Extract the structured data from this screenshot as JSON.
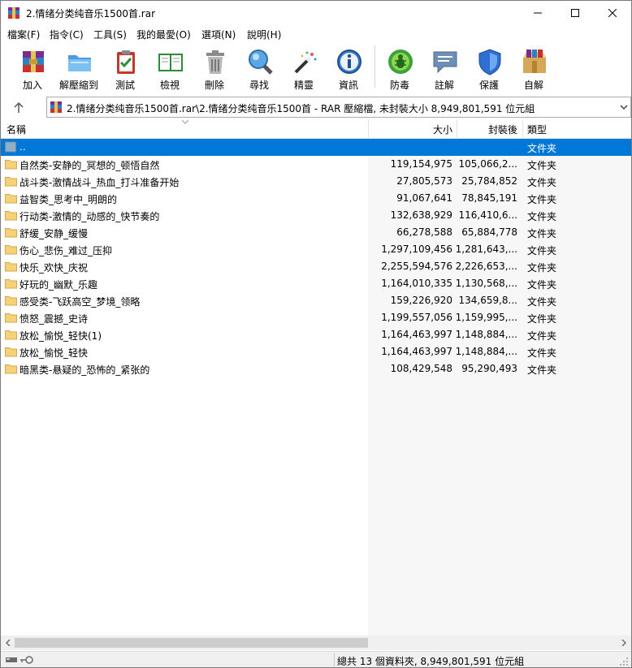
{
  "window": {
    "title": "2.情绪分类纯音乐1500首.rar",
    "controls": [
      "minimize",
      "maximize",
      "close"
    ]
  },
  "menu": [
    "檔案(F)",
    "指令(C)",
    "工具(S)",
    "我的最愛(O)",
    "選項(N)",
    "說明(H)"
  ],
  "toolbar": [
    {
      "label": "加入",
      "icon": "add-archive-icon"
    },
    {
      "label": "解壓縮到",
      "icon": "extract-folder-icon"
    },
    {
      "label": "測試",
      "icon": "test-clipboard-icon"
    },
    {
      "label": "檢視",
      "icon": "view-book-icon"
    },
    {
      "label": "刪除",
      "icon": "trash-can-icon"
    },
    {
      "label": "尋找",
      "icon": "magnifier-icon"
    },
    {
      "label": "精靈",
      "icon": "magic-wand-icon"
    },
    {
      "label": "資訊",
      "icon": "info-icon"
    },
    {
      "label": "防毒",
      "icon": "antivirus-bug-icon"
    },
    {
      "label": "註解",
      "icon": "comment-icon"
    },
    {
      "label": "保護",
      "icon": "shield-icon"
    },
    {
      "label": "自解",
      "icon": "sfx-box-icon"
    }
  ],
  "address": {
    "text": "2.情绪分类纯音乐1500首.rar\\2.情绪分类纯音乐1500首 - RAR 壓縮檔, 未封裝大小 8,949,801,591 位元組"
  },
  "columns": {
    "name": "名稱",
    "size": "大小",
    "packed": "封裝後",
    "type": "類型"
  },
  "rows": [
    {
      "name": "..",
      "size": "",
      "packed": "",
      "type": "文件夹",
      "selected": true,
      "parent": true
    },
    {
      "name": "自然类-安静的_冥想的_顿悟自然",
      "size": "119,154,975",
      "packed": "105,066,2...",
      "type": "文件夹"
    },
    {
      "name": "战斗类-激情战斗_热血_打斗准备开始",
      "size": "27,805,573",
      "packed": "25,784,852",
      "type": "文件夹"
    },
    {
      "name": "益智类_思考中_明朗的",
      "size": "91,067,641",
      "packed": "78,845,191",
      "type": "文件夹"
    },
    {
      "name": "行动类-激情的_动感的_快节奏的",
      "size": "132,638,929",
      "packed": "116,410,6...",
      "type": "文件夹"
    },
    {
      "name": "舒缓_安静_缓慢",
      "size": "66,278,588",
      "packed": "65,884,778",
      "type": "文件夹"
    },
    {
      "name": "伤心_悲伤_难过_压抑",
      "size": "1,297,109,456",
      "packed": "1,281,643,...",
      "type": "文件夹"
    },
    {
      "name": "快乐_欢快_庆祝",
      "size": "2,255,594,576",
      "packed": "2,226,653,...",
      "type": "文件夹"
    },
    {
      "name": "好玩的_幽默_乐趣",
      "size": "1,164,010,335",
      "packed": "1,130,568,...",
      "type": "文件夹"
    },
    {
      "name": "感受类-飞跃高空_梦境_领略",
      "size": "159,226,920",
      "packed": "134,659,8...",
      "type": "文件夹"
    },
    {
      "name": "愤怒_震撼_史诗",
      "size": "1,199,557,056",
      "packed": "1,159,995,...",
      "type": "文件夹"
    },
    {
      "name": "放松_愉悦_轻快(1)",
      "size": "1,164,463,997",
      "packed": "1,148,884,...",
      "type": "文件夹"
    },
    {
      "name": "放松_愉悦_轻快",
      "size": "1,164,463,997",
      "packed": "1,148,884,...",
      "type": "文件夹"
    },
    {
      "name": "暗黑类-悬疑的_恐怖的_紧张的",
      "size": "108,429,548",
      "packed": "95,290,493",
      "type": "文件夹"
    }
  ],
  "status": {
    "text": "總共 13 個資料夾, 8,949,801,591 位元組"
  },
  "colors": {
    "selection": "#0078d7",
    "folder": "#f5d27a"
  }
}
